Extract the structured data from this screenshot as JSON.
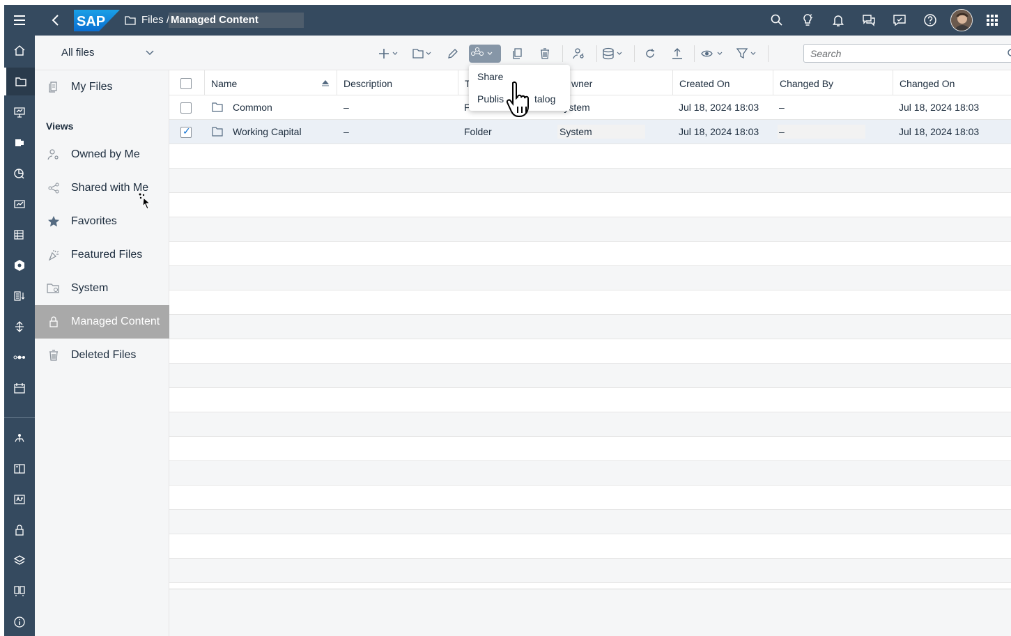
{
  "shell": {
    "logo": "SAP",
    "breadcrumb_parent": "Files /",
    "breadcrumb_current": "Managed Content"
  },
  "toolbar": {
    "dropdown_label": "All files",
    "search_placeholder": "Search"
  },
  "side": {
    "my_files": "My Files",
    "views_heading": "Views",
    "items": [
      {
        "label": "Owned by Me",
        "icon": "owned-icon"
      },
      {
        "label": "Shared with Me",
        "icon": "share-icon"
      },
      {
        "label": "Favorites",
        "icon": "star-icon"
      },
      {
        "label": "Featured Files",
        "icon": "featured-icon"
      },
      {
        "label": "System",
        "icon": "system-icon"
      },
      {
        "label": "Managed Content",
        "icon": "lock-icon",
        "selected": true
      },
      {
        "label": "Deleted Files",
        "icon": "trash-icon"
      }
    ]
  },
  "table": {
    "columns": [
      "Name",
      "Description",
      "Ty",
      "wner",
      "Created On",
      "Changed By",
      "Changed On"
    ],
    "rows": [
      {
        "name": "Common",
        "description": "–",
        "type": "Folder",
        "owner": "System",
        "created": "Jul 18, 2024 18:03",
        "changed_by": "–",
        "changed_on": "Jul 18, 2024 18:03",
        "checked": false
      },
      {
        "name": "Working Capital",
        "description": "–",
        "type": "Folder",
        "owner": "System",
        "created": "Jul 18, 2024 18:03",
        "changed_by": "–",
        "changed_on": "Jul 18, 2024 18:03",
        "checked": true
      }
    ]
  },
  "popover": {
    "share": "Share",
    "publish": "Publis",
    "publish_tail": "talog"
  },
  "colors": {
    "shell": "#354a5f",
    "accent": "#0a6ed1",
    "selected_nav": "#a9a9a9"
  }
}
